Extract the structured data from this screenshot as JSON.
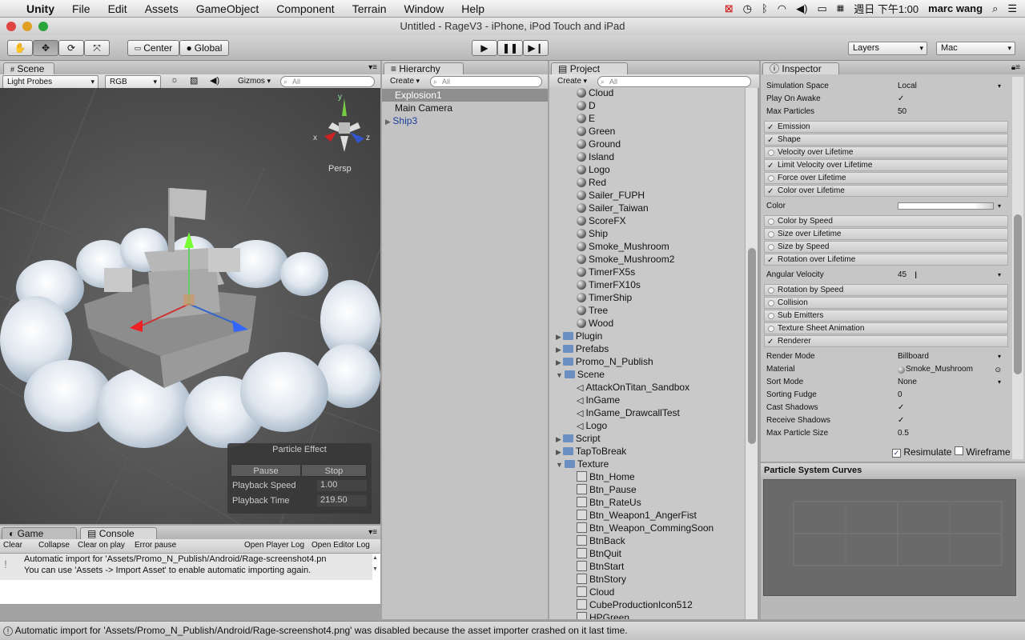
{
  "menubar": {
    "app": "Unity",
    "items": [
      "File",
      "Edit",
      "Assets",
      "GameObject",
      "Component",
      "Terrain",
      "Window",
      "Help"
    ],
    "clock": "週日 下午1:00",
    "user": "marc wang"
  },
  "window": {
    "title": "Untitled - RageV3 - iPhone, iPod Touch and iPad"
  },
  "toolbar": {
    "pivot": "Center",
    "space": "Global",
    "layers": "Layers",
    "layout": "Mac"
  },
  "scene": {
    "tab": "Scene",
    "mode": "Light Probes",
    "render": "RGB",
    "gizmos": "Gizmos",
    "search_placeholder": "All",
    "persp": "Persp",
    "axes": {
      "x": "x",
      "y": "y",
      "z": "z"
    }
  },
  "particle_effect": {
    "title": "Particle Effect",
    "pause": "Pause",
    "stop": "Stop",
    "speed_label": "Playback Speed",
    "speed_value": "1.00",
    "time_label": "Playback Time",
    "time_value": "219.50"
  },
  "console": {
    "tabs": [
      "Game",
      "Console"
    ],
    "buttons": [
      "Clear",
      "Collapse",
      "Clear on play",
      "Error pause",
      "Open Player Log",
      "Open Editor Log"
    ],
    "message_line1": "Automatic import for 'Assets/Promo_N_Publish/Android/Rage-screenshot4.pn",
    "message_line2": "You can use 'Assets -> Import Asset' to enable automatic importing again."
  },
  "hierarchy": {
    "tab": "Hierarchy",
    "create": "Create",
    "search_placeholder": "All",
    "items": [
      {
        "label": "Explosion1"
      },
      {
        "label": "Main Camera"
      },
      {
        "label": "Ship3"
      }
    ]
  },
  "project": {
    "tab": "Project",
    "create": "Create",
    "search_placeholder": "All",
    "items": [
      {
        "label": "Cloud",
        "icon": "sphere",
        "indent": 1
      },
      {
        "label": "D",
        "icon": "sphere",
        "indent": 1
      },
      {
        "label": "E",
        "icon": "sphere",
        "indent": 1
      },
      {
        "label": "Green",
        "icon": "sphere",
        "indent": 1
      },
      {
        "label": "Ground",
        "icon": "sphere",
        "indent": 1
      },
      {
        "label": "Island",
        "icon": "sphere",
        "indent": 1
      },
      {
        "label": "Logo",
        "icon": "sphere",
        "indent": 1
      },
      {
        "label": "Red",
        "icon": "sphere",
        "indent": 1
      },
      {
        "label": "Sailer_FUPH",
        "icon": "sphere",
        "indent": 1
      },
      {
        "label": "Sailer_Taiwan",
        "icon": "sphere",
        "indent": 1
      },
      {
        "label": "ScoreFX",
        "icon": "sphere",
        "indent": 1
      },
      {
        "label": "Ship",
        "icon": "sphere",
        "indent": 1
      },
      {
        "label": "Smoke_Mushroom",
        "icon": "sphere",
        "indent": 1
      },
      {
        "label": "Smoke_Mushroom2",
        "icon": "sphere",
        "indent": 1
      },
      {
        "label": "TimerFX5s",
        "icon": "sphere",
        "indent": 1
      },
      {
        "label": "TimerFX10s",
        "icon": "sphere",
        "indent": 1
      },
      {
        "label": "TimerShip",
        "icon": "sphere",
        "indent": 1
      },
      {
        "label": "Tree",
        "icon": "sphere",
        "indent": 1
      },
      {
        "label": "Wood",
        "icon": "sphere",
        "indent": 1
      },
      {
        "label": "Plugin",
        "icon": "folder",
        "indent": 0,
        "arrow": "▶"
      },
      {
        "label": "Prefabs",
        "icon": "folder",
        "indent": 0,
        "arrow": "▶"
      },
      {
        "label": "Promo_N_Publish",
        "icon": "folder",
        "indent": 0,
        "arrow": "▶"
      },
      {
        "label": "Scene",
        "icon": "folder",
        "indent": 0,
        "arrow": "▼"
      },
      {
        "label": "AttackOnTitan_Sandbox",
        "icon": "unity",
        "indent": 1
      },
      {
        "label": "InGame",
        "icon": "unity",
        "indent": 1
      },
      {
        "label": "InGame_DrawcallTest",
        "icon": "unity",
        "indent": 1
      },
      {
        "label": "Logo",
        "icon": "unity",
        "indent": 1
      },
      {
        "label": "Script",
        "icon": "folder",
        "indent": 0,
        "arrow": "▶"
      },
      {
        "label": "TapToBreak",
        "icon": "folder",
        "indent": 0,
        "arrow": "▶"
      },
      {
        "label": "Texture",
        "icon": "folder",
        "indent": 0,
        "arrow": "▼"
      },
      {
        "label": "Btn_Home",
        "icon": "tex",
        "indent": 1
      },
      {
        "label": "Btn_Pause",
        "icon": "tex",
        "indent": 1
      },
      {
        "label": "Btn_RateUs",
        "icon": "tex",
        "indent": 1
      },
      {
        "label": "Btn_Weapon1_AngerFist",
        "icon": "tex",
        "indent": 1
      },
      {
        "label": "Btn_Weapon_CommingSoon",
        "icon": "tex",
        "indent": 1
      },
      {
        "label": "BtnBack",
        "icon": "tex",
        "indent": 1
      },
      {
        "label": "BtnQuit",
        "icon": "tex",
        "indent": 1
      },
      {
        "label": "BtnStart",
        "icon": "tex",
        "indent": 1
      },
      {
        "label": "BtnStory",
        "icon": "tex",
        "indent": 1
      },
      {
        "label": "Cloud",
        "icon": "tex",
        "indent": 1
      },
      {
        "label": "CubeProductionIcon512",
        "icon": "tex",
        "indent": 1
      },
      {
        "label": "HPGreen",
        "icon": "tex",
        "indent": 1
      }
    ]
  },
  "inspector": {
    "tab": "Inspector",
    "props_top": [
      {
        "label": "Simulation Space",
        "value": "Local"
      },
      {
        "label": "Play On Awake",
        "value": "✓"
      },
      {
        "label": "Max Particles",
        "value": "50"
      }
    ],
    "modules": [
      {
        "label": "Emission",
        "checked": true
      },
      {
        "label": "Shape",
        "checked": true
      },
      {
        "label": "Velocity over Lifetime",
        "checked": false
      },
      {
        "label": "Limit Velocity over Lifetime",
        "checked": true
      },
      {
        "label": "Force over Lifetime",
        "checked": false
      },
      {
        "label": "Color over Lifetime",
        "checked": true
      }
    ],
    "color_label": "Color",
    "modules2": [
      {
        "label": "Color by Speed",
        "checked": false
      },
      {
        "label": "Size over Lifetime",
        "checked": false
      },
      {
        "label": "Size by Speed",
        "checked": false
      },
      {
        "label": "Rotation over Lifetime",
        "checked": true
      }
    ],
    "angular_label": "Angular Velocity",
    "angular_value": "45",
    "modules3": [
      {
        "label": "Rotation by Speed",
        "checked": false
      },
      {
        "label": "Collision",
        "checked": false
      },
      {
        "label": "Sub Emitters",
        "checked": false
      },
      {
        "label": "Texture Sheet Animation",
        "checked": false
      },
      {
        "label": "Renderer",
        "checked": true
      }
    ],
    "renderer_props": [
      {
        "label": "Render Mode",
        "value": "Billboard"
      },
      {
        "label": "Material",
        "value": "Smoke_Mushroom"
      },
      {
        "label": "Sort Mode",
        "value": "None"
      },
      {
        "label": "Sorting Fudge",
        "value": "0"
      },
      {
        "label": "Cast Shadows",
        "value": "✓"
      },
      {
        "label": "Receive Shadows",
        "value": "✓"
      },
      {
        "label": "Max Particle Size",
        "value": "0.5"
      }
    ],
    "resimulate": "Resimulate",
    "wireframe": "Wireframe",
    "curves_title": "Particle System Curves"
  },
  "statusbar": {
    "message": "Automatic import for 'Assets/Promo_N_Publish/Android/Rage-screenshot4.png' was disabled because the asset importer crashed on it last time."
  }
}
